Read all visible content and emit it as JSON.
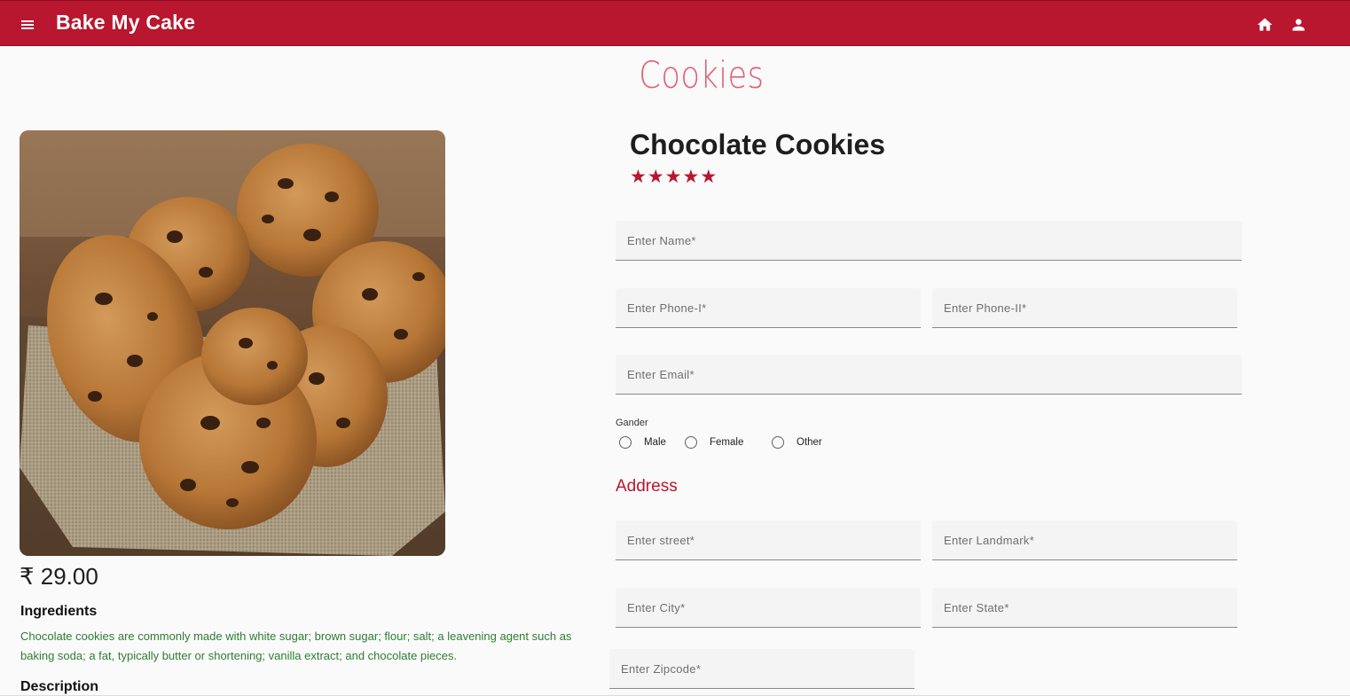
{
  "header": {
    "brand": "Bake My Cake",
    "icons": [
      "menu-icon",
      "home-icon",
      "account-icon"
    ],
    "color": "#b8172f"
  },
  "page": {
    "category_title": "Cookies"
  },
  "product": {
    "name": "Chocolate Cookies",
    "rating": 5,
    "stars": "★★★★★",
    "price": "₹ 29.00",
    "ingredients_heading": "Ingredients",
    "ingredients_text": "Chocolate cookies are commonly made with white sugar; brown sugar; flour; salt; a leavening agent such as baking soda; a fat, typically butter or shortening; vanilla extract; and chocolate pieces.",
    "description_heading": "Description"
  },
  "form": {
    "name_placeholder": "Enter Name*",
    "phone1_placeholder": "Enter Phone-I*",
    "phone2_placeholder": "Enter Phone-II*",
    "email_placeholder": "Enter Email*",
    "gender_label": "Gander",
    "gender_options": [
      "Male",
      "Female",
      "Other"
    ],
    "address_heading": "Address",
    "street_placeholder": "Enter street*",
    "landmark_placeholder": "Enter Landmark*",
    "city_placeholder": "Enter City*",
    "state_placeholder": "Enter State*",
    "zipcode_placeholder": "Enter Zipcode*"
  },
  "colors": {
    "accent": "#b8172f",
    "category_title": "#e05f73",
    "ingredients_text": "#2e7d32"
  }
}
